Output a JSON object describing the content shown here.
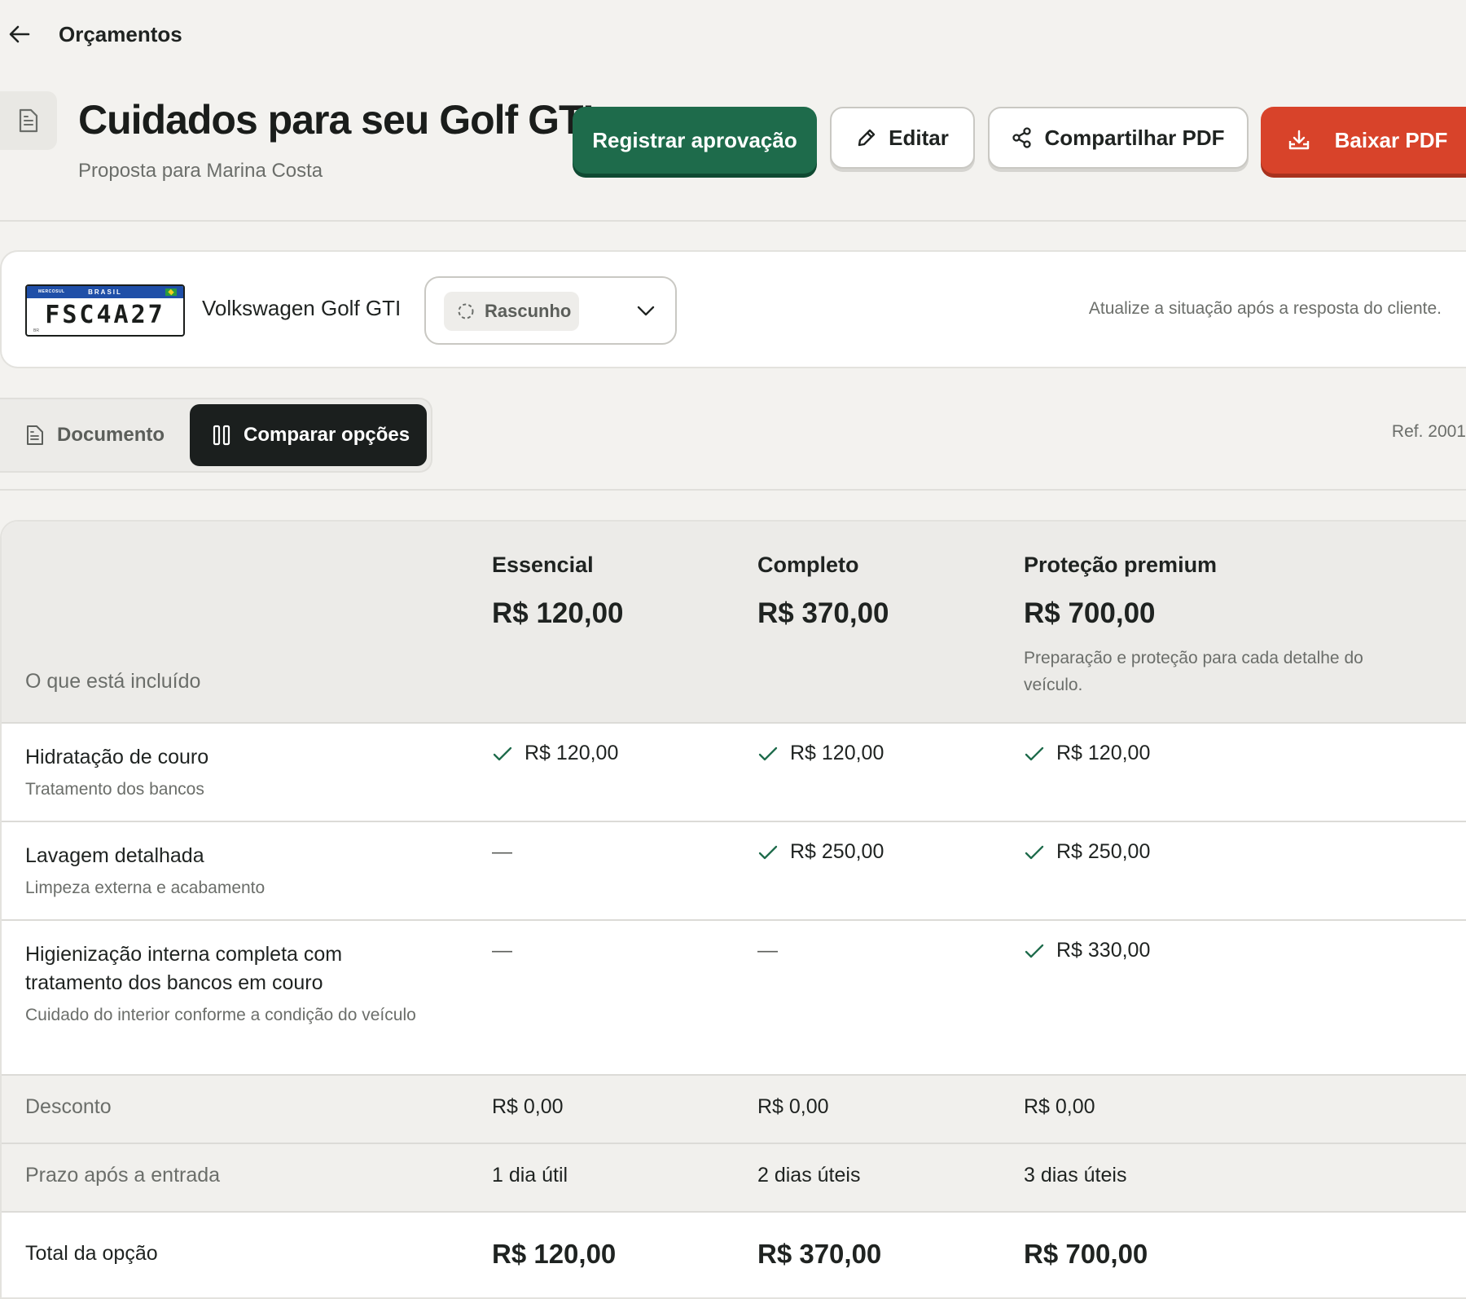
{
  "nav": {
    "back_label": "Orçamentos"
  },
  "header": {
    "title": "Cuidados para seu Golf GTI",
    "subtitle": "Proposta para Marina Costa",
    "actions": {
      "approve": "Registrar aprovação",
      "edit": "Editar",
      "share": "Compartilhar PDF",
      "download": "Baixar PDF"
    }
  },
  "vehicle": {
    "plate": {
      "number": "FSC4A27",
      "country": "BRASIL",
      "region": "MERCOSUL",
      "code": "BR"
    },
    "name": "Volkswagen Golf GTI",
    "status": {
      "selected": "Rascunho"
    },
    "hint": "Atualize a situação após a resposta do cliente."
  },
  "tabs": [
    {
      "label": "Documento",
      "active": false
    },
    {
      "label": "Comparar opções",
      "active": true
    }
  ],
  "ref": "Ref. 2001",
  "comparison": {
    "included_label": "O que está incluído",
    "plans": [
      {
        "name": "Essencial",
        "price": "R$ 120,00",
        "description": ""
      },
      {
        "name": "Completo",
        "price": "R$ 370,00",
        "description": ""
      },
      {
        "name": "Proteção premium",
        "price": "R$ 700,00",
        "description": "Preparação e proteção para cada detalhe do veículo."
      }
    ],
    "items": [
      {
        "title": "Hidratação de couro",
        "subtitle": "Tratamento dos bancos",
        "values": [
          "R$ 120,00",
          "R$ 120,00",
          "R$ 120,00"
        ]
      },
      {
        "title": "Lavagem detalhada",
        "subtitle": "Limpeza externa e acabamento",
        "values": [
          "—",
          "R$ 250,00",
          "R$ 250,00"
        ]
      },
      {
        "title": "Higienização interna completa com tratamento dos bancos em couro",
        "subtitle": "Cuidado do interior conforme a condição do veículo",
        "values": [
          "—",
          "—",
          "R$ 330,00"
        ]
      }
    ],
    "discount": {
      "label": "Desconto",
      "values": [
        "R$ 0,00",
        "R$ 0,00",
        "R$ 0,00"
      ]
    },
    "lead_time": {
      "label": "Prazo após a entrada",
      "values": [
        "1 dia útil",
        "2 dias úteis",
        "3 dias úteis"
      ]
    },
    "total": {
      "label": "Total da opção",
      "values": [
        "R$ 120,00",
        "R$ 370,00",
        "R$ 700,00"
      ]
    }
  },
  "colors": {
    "approve": "#1e6b4b",
    "download": "#d8432a",
    "active_tab": "#1b1f1e",
    "check": "#1e6b4b"
  },
  "icons": {
    "back": "arrow-left-icon",
    "document": "document-icon",
    "edit": "pencil-icon",
    "share": "share-icon",
    "download": "download-icon",
    "status": "dashed-circle-icon",
    "dropdown": "chevron-down-icon",
    "compare": "columns-icon",
    "check": "check-icon"
  }
}
